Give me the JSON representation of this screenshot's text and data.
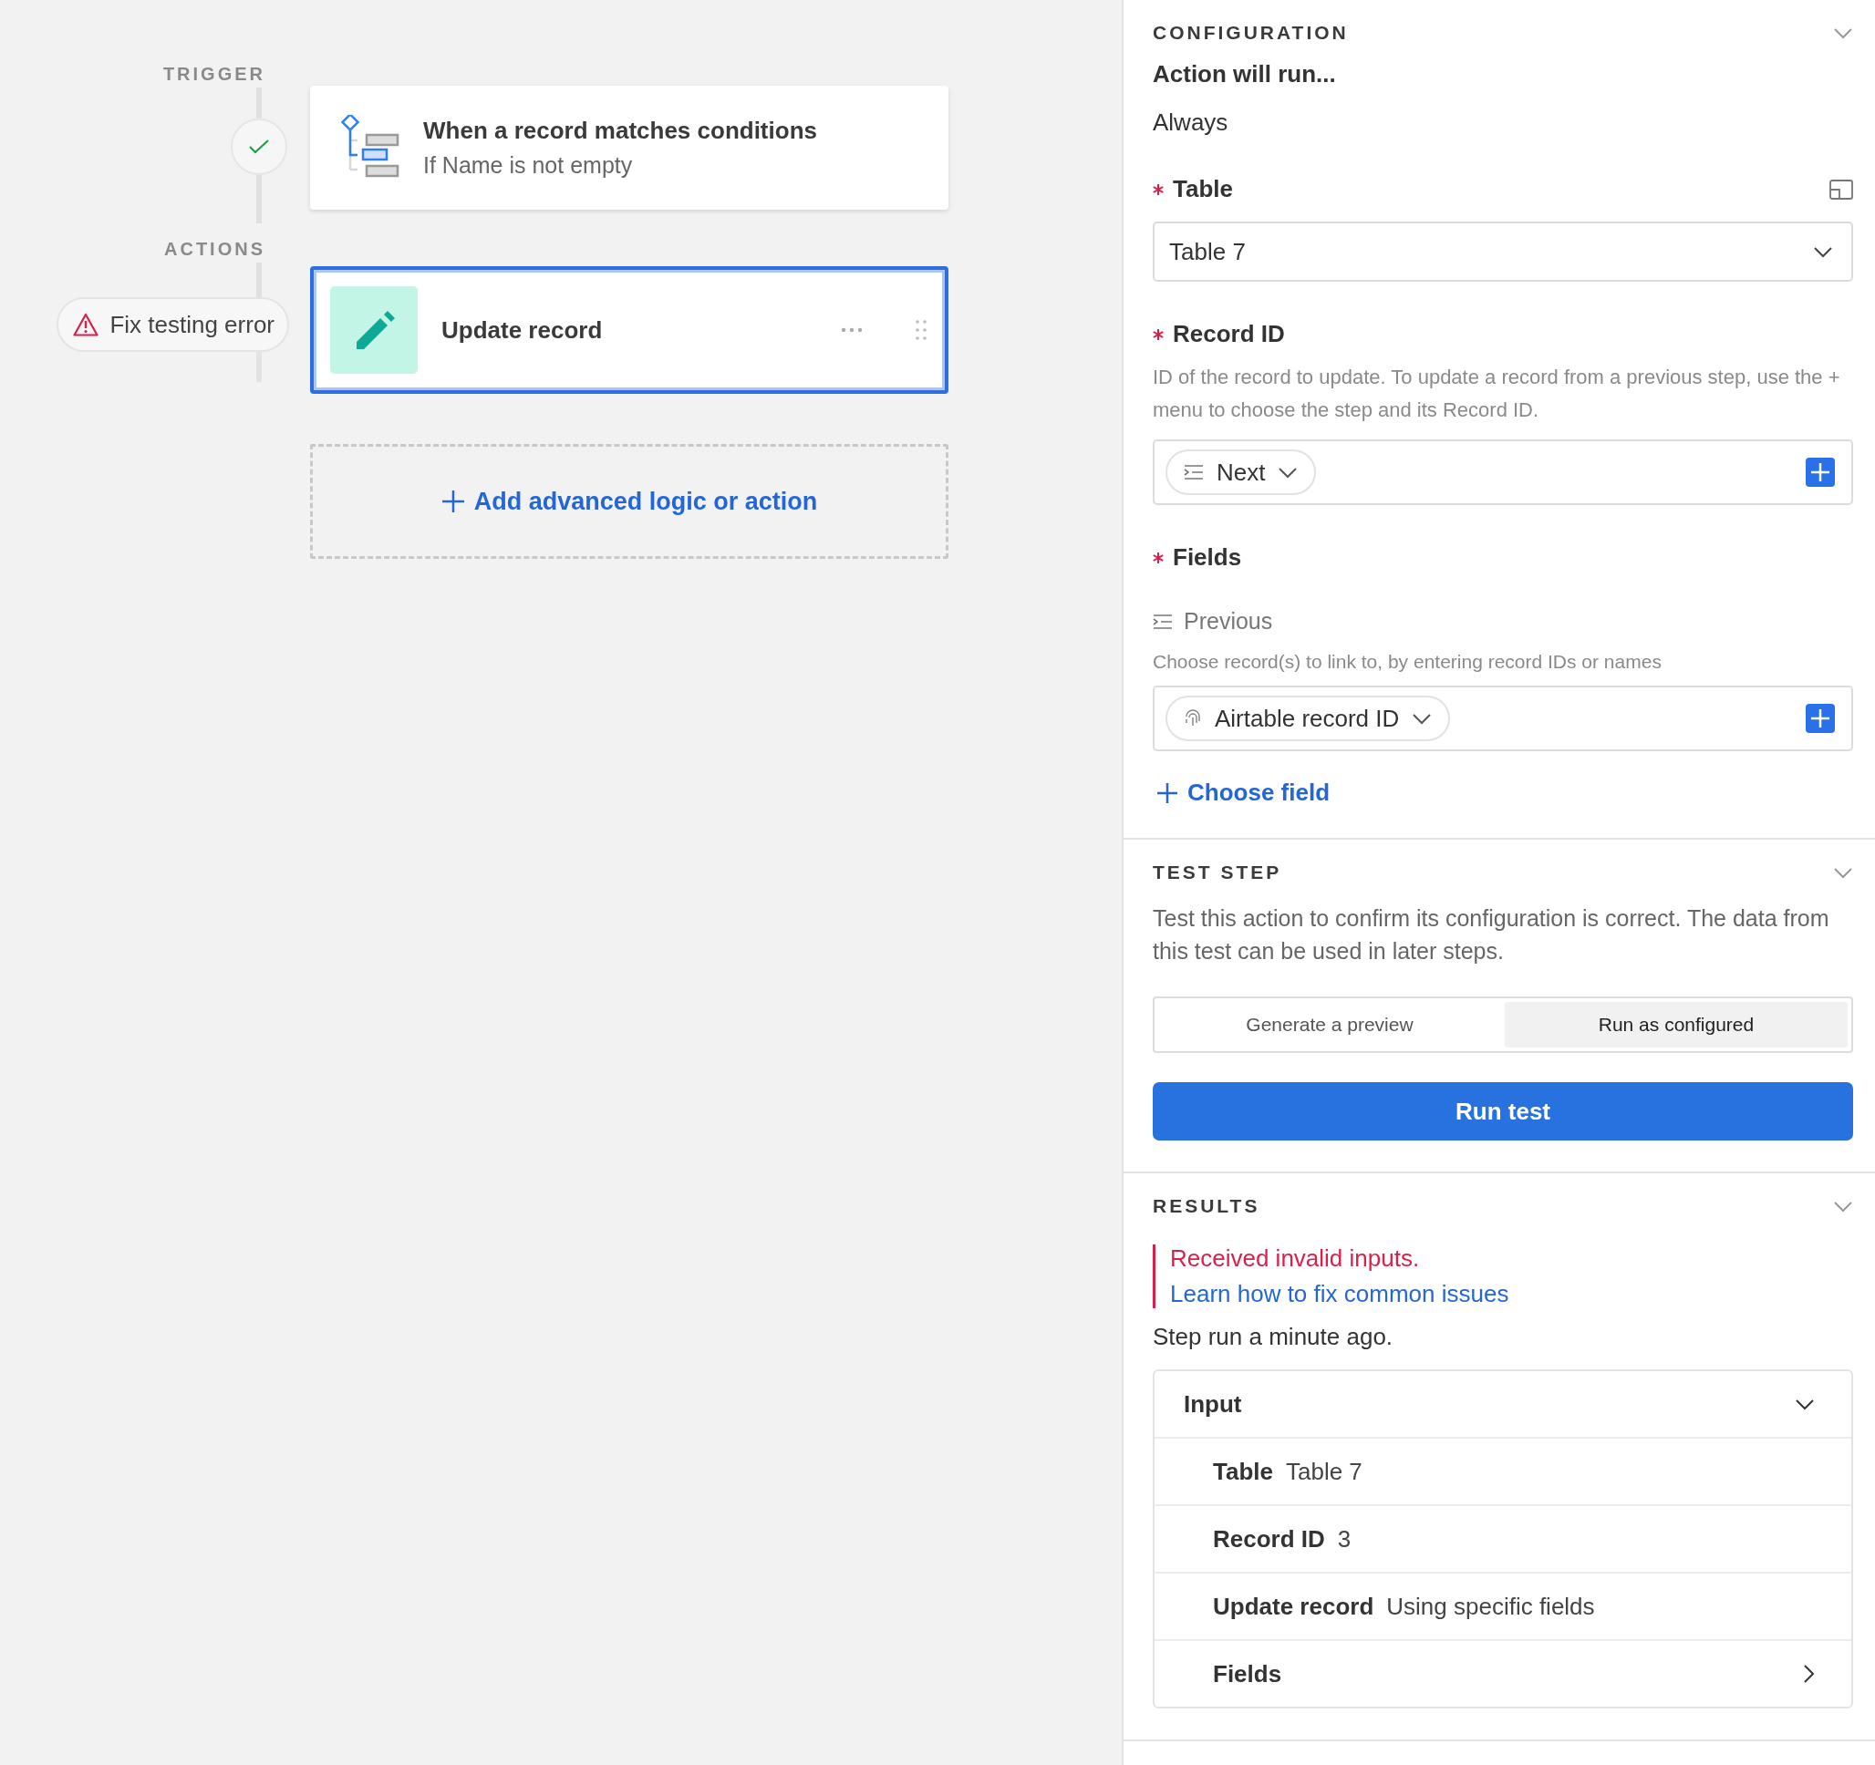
{
  "canvas": {
    "trigger_label": "TRIGGER",
    "trigger_status": {
      "checked": true
    },
    "trigger": {
      "title": "When a record matches conditions",
      "subtitle": "If Name is not empty"
    },
    "actions_label": "ACTIONS",
    "error_badge": "Fix testing error",
    "actions": [
      {
        "title": "Update record",
        "selected": true
      }
    ],
    "add_button": "Add advanced logic or action"
  },
  "configuration": {
    "title": "CONFIGURATION",
    "expanded": true,
    "run_label": "Action will run...",
    "run_value": "Always",
    "table": {
      "label": "Table",
      "required": true,
      "value": "Table 7"
    },
    "record_id": {
      "label": "Record ID",
      "required": true,
      "description": "ID of the record to update. To update a record from a previous step, use the + menu to choose the step and its Record ID.",
      "token": "Next"
    },
    "fields": {
      "label": "Fields",
      "required": true,
      "field_name": "Previous",
      "hint": "Choose record(s) to link to, by entering record IDs or names",
      "token": "Airtable record ID"
    },
    "choose_field": "Choose field"
  },
  "test_step": {
    "title": "TEST STEP",
    "expanded": true,
    "description": "Test this action to confirm its configuration is correct. The data from this test can be used in later steps.",
    "modes": [
      {
        "label": "Generate a preview",
        "selected": false
      },
      {
        "label": "Run as configured",
        "selected": true
      }
    ],
    "run_button": "Run test"
  },
  "results": {
    "title": "RESULTS",
    "expanded": true,
    "error": "Received invalid inputs.",
    "help_link": "Learn how to fix common issues",
    "status": "Step run a minute ago.",
    "input": {
      "title": "Input",
      "expanded": true,
      "rows": [
        {
          "kind": "pair",
          "label": "Table",
          "value": "Table 7"
        },
        {
          "kind": "pair",
          "label": "Record ID",
          "value": "3"
        },
        {
          "kind": "pair",
          "label": "Update record",
          "value": "Using specific fields"
        },
        {
          "kind": "link",
          "label": "Fields"
        }
      ]
    }
  }
}
